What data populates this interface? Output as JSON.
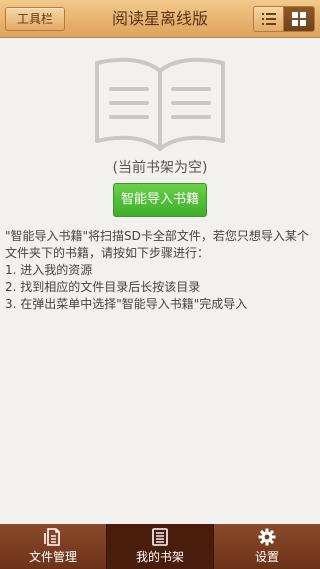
{
  "header": {
    "toolbar_label": "工具栏",
    "title": "阅读星离线版"
  },
  "main": {
    "empty_text": "(当前书架为空)",
    "import_button": "智能导入书籍",
    "instructions": [
      "\"智能导入书籍\"将扫描SD卡全部文件，若您只想导入某个文件夹下的书籍，请按如下步骤进行：",
      "1. 进入我的资源",
      "2. 找到相应的文件目录后长按该目录",
      "3. 在弹出菜单中选择\"智能导入书籍\"完成导入"
    ]
  },
  "bottom_nav": [
    {
      "label": "文件管理",
      "icon": "file-manager-icon"
    },
    {
      "label": "我的书架",
      "icon": "bookshelf-icon",
      "active": true
    },
    {
      "label": "设置",
      "icon": "gear-icon"
    }
  ],
  "colors": {
    "header": "#e8b36f",
    "nav": "#7a3c20",
    "nav_active": "#4a1c0b",
    "import_button": "#4cbc34"
  }
}
